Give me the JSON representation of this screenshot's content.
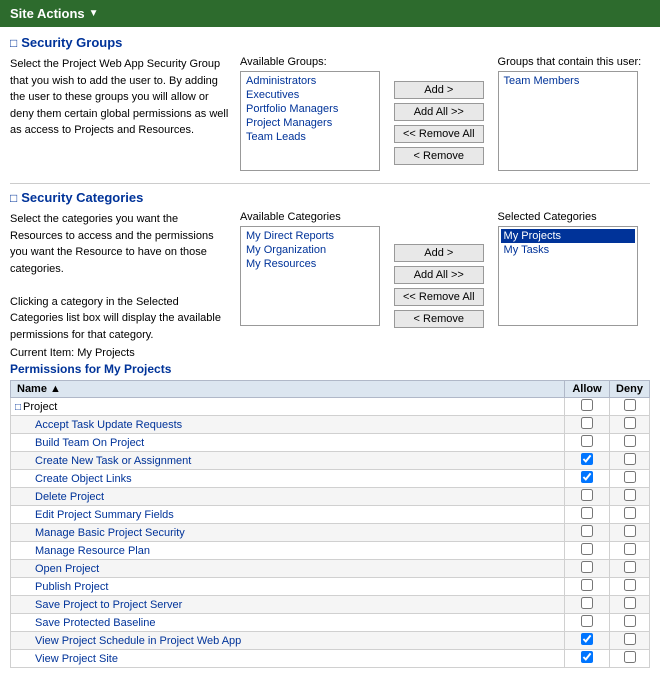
{
  "topbar": {
    "label": "Site Actions",
    "arrow": "▼"
  },
  "securityGroups": {
    "icon": "▣",
    "title": "Security Groups",
    "description": "Select the Project Web App Security Group that you wish to add the user to. By adding the user to these groups you will allow or deny them certain global permissions as well as access to Projects and Resources.",
    "availableLabel": "Available Groups:",
    "availableItems": [
      "Administrators",
      "Executives",
      "Portfolio Managers",
      "Project Managers",
      "Team Leads"
    ],
    "buttons": {
      "add": "Add >",
      "addAll": "Add All >>",
      "removeAll": "<< Remove All",
      "remove": "< Remove"
    },
    "selectedLabel": "Groups that contain this user:",
    "selectedItems": [
      "Team Members"
    ]
  },
  "securityCategories": {
    "icon": "▣",
    "title": "Security Categories",
    "description": "Select the categories you want the Resources to access and the permissions you want the Resource to have on those categories.\n\nClicking a category in the Selected Categories list box will display the available permissions for that category.",
    "availableLabel": "Available Categories",
    "availableItems": [
      "My Direct Reports",
      "My Organization",
      "My Resources"
    ],
    "buttons": {
      "add": "Add >",
      "addAll": "Add All >>",
      "removeAll": "<< Remove All",
      "remove": "< Remove"
    },
    "selectedLabel": "Selected Categories",
    "selectedItems": [
      {
        "label": "My Projects",
        "selected": true
      },
      {
        "label": "My Tasks",
        "selected": false
      }
    ]
  },
  "permissions": {
    "currentItem": "Current Item: My Projects",
    "title": "Permissions for My Projects",
    "columns": {
      "name": "Name",
      "sortIcon": "▲",
      "allow": "Allow",
      "deny": "Deny"
    },
    "rows": [
      {
        "label": "Project",
        "type": "group",
        "indent": false,
        "allow": false,
        "deny": false
      },
      {
        "label": "Accept Task Update Requests",
        "type": "item",
        "indent": true,
        "allow": false,
        "deny": false
      },
      {
        "label": "Build Team On Project",
        "type": "item",
        "indent": true,
        "allow": false,
        "deny": false
      },
      {
        "label": "Create New Task or Assignment",
        "type": "item",
        "indent": true,
        "allow": true,
        "deny": false
      },
      {
        "label": "Create Object Links",
        "type": "item",
        "indent": true,
        "allow": true,
        "deny": false
      },
      {
        "label": "Delete Project",
        "type": "item",
        "indent": true,
        "allow": false,
        "deny": false
      },
      {
        "label": "Edit Project Summary Fields",
        "type": "item",
        "indent": true,
        "allow": false,
        "deny": false
      },
      {
        "label": "Manage Basic Project Security",
        "type": "item",
        "indent": true,
        "allow": false,
        "deny": false
      },
      {
        "label": "Manage Resource Plan",
        "type": "item",
        "indent": true,
        "allow": false,
        "deny": false
      },
      {
        "label": "Open Project",
        "type": "item",
        "indent": true,
        "allow": false,
        "deny": false
      },
      {
        "label": "Publish Project",
        "type": "item",
        "indent": true,
        "allow": false,
        "deny": false
      },
      {
        "label": "Save Project to Project Server",
        "type": "item",
        "indent": true,
        "allow": false,
        "deny": false
      },
      {
        "label": "Save Protected Baseline",
        "type": "item",
        "indent": true,
        "allow": false,
        "deny": false
      },
      {
        "label": "View Project Schedule in Project Web App",
        "type": "item",
        "indent": true,
        "allow": true,
        "deny": false
      },
      {
        "label": "View Project Site",
        "type": "item",
        "indent": true,
        "allow": true,
        "deny": false
      }
    ]
  }
}
